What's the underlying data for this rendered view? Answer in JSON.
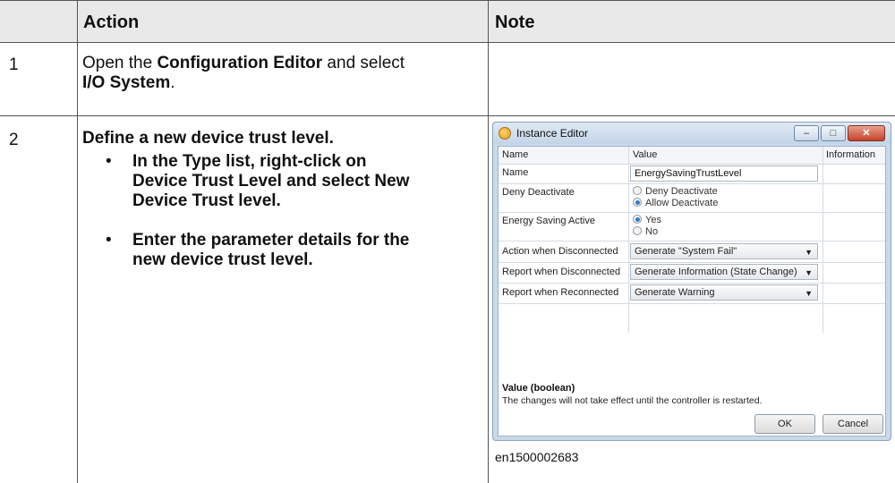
{
  "table": {
    "header": {
      "step": "",
      "action": "Action",
      "note": "Note"
    },
    "row1": {
      "step": "1",
      "action_prefix": "Open the ",
      "action_bold1": "Configuration Editor",
      "action_mid": " and select",
      "action_bold2": "I/O System",
      "action_suffix": "."
    },
    "row2": {
      "step": "2",
      "action": "Define a new device trust level.",
      "bullet1": {
        "t1": "In the ",
        "b1": "Type",
        "t2": " list, right-click on",
        "b2": "Device Trust Level",
        "t3": " and select ",
        "b3": "New",
        "b4": "Device Trust level",
        "t4": "."
      },
      "bullet2": {
        "line1": "Enter the parameter details for the",
        "line2": "new device trust level."
      },
      "bullet_char": "•"
    }
  },
  "dialog": {
    "title": "Instance Editor",
    "window_buttons": {
      "minimize": "–",
      "maximize": "□",
      "close": "✕"
    },
    "columns": [
      "Name",
      "Value",
      "Information"
    ],
    "rows": {
      "name": {
        "label": "Name",
        "value": "EnergySavingTrustLevel"
      },
      "deny": {
        "label": "Deny Deactivate",
        "opt1": "Deny Deactivate",
        "opt2": "Allow Deactivate",
        "selected": "Allow Deactivate"
      },
      "energy": {
        "label": "Energy Saving Active",
        "opt1": "Yes",
        "opt2": "No",
        "selected": "Yes"
      },
      "action_disc": {
        "label": "Action when Disconnected",
        "value": "Generate \"System Fail\""
      },
      "report_disc": {
        "label": "Report when Disconnected",
        "value": "Generate Information (State Change)"
      },
      "report_reconn": {
        "label": "Report when Reconnected",
        "value": "Generate Warning"
      }
    },
    "description_title": "Value (boolean)",
    "description_text": "The changes will not take effect until the controller is restarted.",
    "ok_label": "OK",
    "cancel_label": "Cancel",
    "arrow": "▼"
  },
  "caption": "en1500002683"
}
